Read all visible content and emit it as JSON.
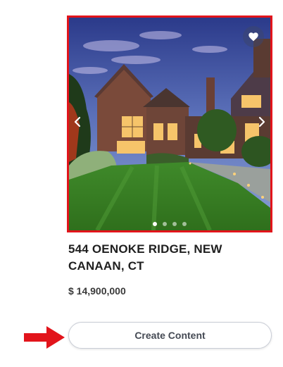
{
  "listing": {
    "address_line1": "544 OENOKE RIDGE, NEW",
    "address_line2": "CANAAN, CT",
    "price": "$ 14,900,000"
  },
  "carousel": {
    "dots": [
      {
        "active": true
      },
      {
        "active": false
      },
      {
        "active": false
      },
      {
        "active": false
      }
    ],
    "favorite_icon": "heart-icon",
    "prev_icon": "chevron-left-icon",
    "next_icon": "chevron-right-icon"
  },
  "actions": {
    "create_content_label": "Create Content"
  },
  "colors": {
    "highlight_border": "#e2141b",
    "annotation_arrow": "#e2141b",
    "button_border": "#c9cdd6",
    "text_primary": "#1f1f1f"
  }
}
